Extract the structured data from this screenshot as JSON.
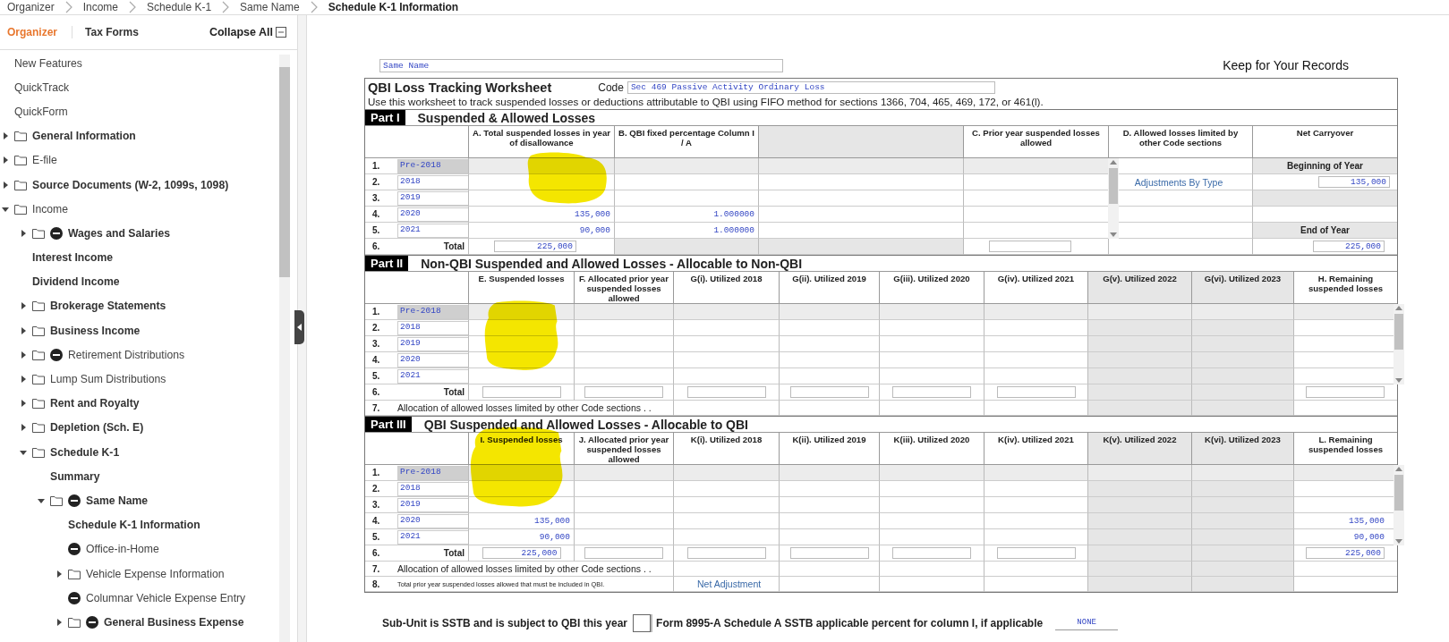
{
  "breadcrumb": [
    "Organizer",
    "Income",
    "Schedule K-1",
    "Same Name",
    "Schedule K-1 Information"
  ],
  "sidebar": {
    "tabs": [
      {
        "label": "Organizer",
        "selected": true
      },
      {
        "label": "Tax Forms",
        "selected": false
      }
    ],
    "collapse_all": "Collapse All",
    "items": [
      {
        "label": "New Features",
        "kind": "link",
        "status": false,
        "bold": false
      },
      {
        "label": "QuickTrack",
        "kind": "link",
        "status": false,
        "bold": false
      },
      {
        "label": "QuickForm",
        "kind": "link",
        "status": false,
        "bold": false
      },
      {
        "label": "General Information",
        "kind": "folder",
        "expanded": false,
        "status": false,
        "bold": true
      },
      {
        "label": "E-file",
        "kind": "folder",
        "expanded": false,
        "status": false,
        "bold": false
      },
      {
        "label": "Source Documents (W-2, 1099s, 1098)",
        "kind": "folder",
        "expanded": false,
        "status": false,
        "bold": true
      },
      {
        "label": "Income",
        "kind": "folder",
        "expanded": true,
        "status": false,
        "bold": false,
        "children": [
          {
            "label": "Wages and Salaries",
            "kind": "folder",
            "expanded": false,
            "status": true,
            "bold": true
          },
          {
            "label": "Interest Income",
            "kind": "link",
            "status": false,
            "bold": true
          },
          {
            "label": "Dividend Income",
            "kind": "link",
            "status": false,
            "bold": true
          },
          {
            "label": "Brokerage Statements",
            "kind": "folder",
            "expanded": false,
            "status": false,
            "bold": true
          },
          {
            "label": "Business Income",
            "kind": "folder",
            "expanded": false,
            "status": false,
            "bold": true
          },
          {
            "label": "Retirement Distributions",
            "kind": "folder",
            "expanded": false,
            "status": true,
            "bold": false
          },
          {
            "label": "Lump Sum Distributions",
            "kind": "folder",
            "expanded": false,
            "status": false,
            "bold": false
          },
          {
            "label": "Rent and Royalty",
            "kind": "folder",
            "expanded": false,
            "status": false,
            "bold": true
          },
          {
            "label": "Depletion (Sch. E)",
            "kind": "folder",
            "expanded": false,
            "status": false,
            "bold": true
          },
          {
            "label": "Schedule K-1",
            "kind": "folder",
            "expanded": true,
            "status": false,
            "bold": true,
            "children": [
              {
                "label": "Summary",
                "kind": "link",
                "status": false,
                "bold": true
              },
              {
                "label": "Same Name",
                "kind": "folder",
                "expanded": true,
                "status": true,
                "bold": true,
                "children": [
                  {
                    "label": "Schedule K-1 Information",
                    "kind": "link",
                    "status": false,
                    "bold": true
                  },
                  {
                    "label": "Office-in-Home",
                    "kind": "link",
                    "status": true,
                    "bold": false
                  },
                  {
                    "label": "Vehicle Expense Information",
                    "kind": "folder",
                    "expanded": false,
                    "status": false,
                    "bold": false
                  },
                  {
                    "label": "Columnar Vehicle Expense Entry",
                    "kind": "link",
                    "status": true,
                    "bold": false
                  },
                  {
                    "label": "General Business Expense",
                    "kind": "folder",
                    "expanded": false,
                    "status": true,
                    "bold": true
                  }
                ]
              }
            ]
          }
        ]
      }
    ]
  },
  "form": {
    "name_field": "Same Name",
    "keep_label": "Keep for Your Records",
    "title": "QBI Loss Tracking Worksheet",
    "code_label": "Code",
    "code_value": "Sec 469 Passive Activity Ordinary Loss",
    "description": "Use this worksheet to track suspended losses or deductions attributable to QBI using FIFO method for sections 1366, 704, 465, 469, 172, or 461(l)."
  },
  "part_1": {
    "label": "Part I",
    "title": "Suspended & Allowed Losses",
    "columns": [
      {
        "header": "A. Total suspended losses in year of disallowance",
        "header_shaded": false,
        "total_box": true,
        "total_shaded": false
      },
      {
        "header": "B. QBI fixed percentage Column I / A",
        "header_shaded": false,
        "total_box": false,
        "total_shaded": true
      },
      {
        "header_shaded": true,
        "total_box": false,
        "total_shaded": true
      },
      {
        "header": "C. Prior year suspended losses allowed",
        "header_shaded": false,
        "total_box": true,
        "total_shaded": false
      },
      {
        "header": "D. Allowed losses limited by other Code sections",
        "header_shaded": false,
        "total_box": false,
        "total_shaded": false
      }
    ],
    "carryover_header": "Net Carryover",
    "rows": [
      {
        "num": "1.",
        "year": "Pre-2018",
        "locked": true,
        "carryover": {
          "kind": "heading",
          "text": "Beginning of Year"
        }
      },
      {
        "num": "2.",
        "year": "2018",
        "locked": false,
        "adjustment_link": "Adjustments By Type",
        "carryover": {
          "kind": "value",
          "text": "135,000"
        }
      },
      {
        "num": "3.",
        "year": "2019",
        "locked": false,
        "carryover": {
          "kind": "shaded"
        }
      },
      {
        "num": "4.",
        "year": "2020",
        "locked": false,
        "total_suspended": "135,000",
        "qbi_percentage": "1.000000"
      },
      {
        "num": "5.",
        "year": "2021",
        "locked": false,
        "total_suspended": "90,000",
        "qbi_percentage": "1.000000",
        "carryover": {
          "kind": "heading",
          "text": "End of Year"
        }
      }
    ],
    "total": {
      "num": "6.",
      "label": "Total",
      "total_suspended": "225,000",
      "carryover": "225,000"
    }
  },
  "part_2": {
    "label": "Part II",
    "title": "Non-QBI Suspended and Allowed Losses - Allocable to Non-QBI",
    "columns": [
      {
        "header": "E. Suspended losses",
        "shaded": false
      },
      {
        "header": "F. Allocated prior year suspended losses allowed",
        "shaded": false
      },
      {
        "header": "G(i). Utilized 2018",
        "shaded": false
      },
      {
        "header": "G(ii). Utilized 2019",
        "shaded": false
      },
      {
        "header": "G(iii). Utilized 2020",
        "shaded": false
      },
      {
        "header": "G(iv). Utilized 2021",
        "shaded": false
      },
      {
        "header": "G(v). Utilized 2022",
        "shaded": true
      },
      {
        "header": "G(vi). Utilized 2023",
        "shaded": true
      },
      {
        "header": "H. Remaining suspended losses",
        "shaded": false
      }
    ],
    "rows": [
      {
        "num": "1.",
        "year": "Pre-2018",
        "locked": true
      },
      {
        "num": "2.",
        "year": "2018",
        "locked": false
      },
      {
        "num": "3.",
        "year": "2019",
        "locked": false
      },
      {
        "num": "4.",
        "year": "2020",
        "locked": false
      },
      {
        "num": "5.",
        "year": "2021",
        "locked": false
      }
    ],
    "total": {
      "num": "6.",
      "label": "Total"
    },
    "notes": [
      {
        "num": "7.",
        "label": "Allocation of allowed losses limited by other Code sections . .",
        "small": false
      }
    ]
  },
  "part_3": {
    "label": "Part III",
    "title": "QBI Suspended and Allowed Losses - Allocable to QBI",
    "columns": [
      {
        "header": "I. Suspended losses",
        "shaded": false
      },
      {
        "header": "J. Allocated prior year suspended losses allowed",
        "shaded": false
      },
      {
        "header": "K(i). Utilized 2018",
        "shaded": false
      },
      {
        "header": "K(ii). Utilized 2019",
        "shaded": false
      },
      {
        "header": "K(iii). Utilized 2020",
        "shaded": false
      },
      {
        "header": "K(iv). Utilized 2021",
        "shaded": false
      },
      {
        "header": "K(v). Utilized 2022",
        "shaded": true
      },
      {
        "header": "K(vi). Utilized 2023",
        "shaded": true
      },
      {
        "header": "L. Remaining suspended losses",
        "shaded": false
      }
    ],
    "rows": [
      {
        "num": "1.",
        "year": "Pre-2018",
        "locked": true
      },
      {
        "num": "2.",
        "year": "2018",
        "locked": false
      },
      {
        "num": "3.",
        "year": "2019",
        "locked": false
      },
      {
        "num": "4.",
        "year": "2020",
        "locked": false,
        "suspended": "135,000",
        "remaining": "135,000"
      },
      {
        "num": "5.",
        "year": "2021",
        "locked": false,
        "suspended": "90,000",
        "remaining": "90,000"
      }
    ],
    "total": {
      "num": "6.",
      "label": "Total",
      "suspended": "225,000",
      "remaining": "225,000"
    },
    "notes": [
      {
        "num": "7.",
        "label": "Allocation of allowed losses limited by other Code sections . .",
        "small": false
      },
      {
        "num": "8.",
        "label": "Total prior year suspended losses allowed that must be included in QBI.",
        "small": true,
        "link": "Net Adjustment"
      }
    ]
  },
  "footer": {
    "sstb_label": "Sub-Unit is SSTB and is subject to QBI this year",
    "sstb_checked": false,
    "percent_label": "Form 8995-A Schedule A SSTB applicable percent for column I, if applicable",
    "percent_value": "NONE"
  }
}
